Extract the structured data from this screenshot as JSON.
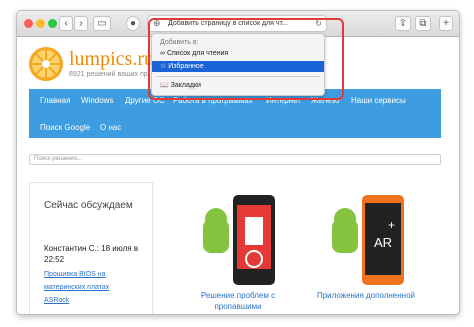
{
  "browser": {
    "address_text": "Добавить страницу в список для чт...",
    "dropdown": {
      "heading": "Добавить в:",
      "items": [
        "Список для чтения",
        "Избранное",
        "Закладки"
      ],
      "selected_index": 1
    }
  },
  "site": {
    "logo": "lumpics.ru",
    "tagline": "8921 решений ваших пр",
    "nav": [
      "Главная",
      "Windows",
      "Другие ОС",
      "Работа в программах",
      "Интернет",
      "Железо",
      "Наши сервисы",
      "Поиск Google",
      "О нас"
    ],
    "search_placeholder": "Поиск решения...",
    "sidebar": {
      "heading": "Сейчас обсуждаем",
      "comment_meta": "Константин С.: 18 июля в 22:52",
      "links": [
        "Прошивка BIOS на",
        "материнских платах",
        "ASRock"
      ]
    },
    "cards": [
      {
        "caption": "Решение проблем с пропавшими"
      },
      {
        "caption": "Приложения дополненной"
      }
    ]
  },
  "colors": {
    "accent_nav": "#3d9de0",
    "logo": "#f08a00",
    "highlight": "#1b64d8",
    "annotation": "#e53935"
  }
}
